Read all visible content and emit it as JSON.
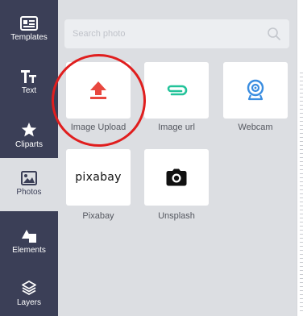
{
  "sidebar": {
    "items": [
      {
        "label": "Templates",
        "icon": "templates-icon"
      },
      {
        "label": "Text",
        "icon": "text-icon"
      },
      {
        "label": "Cliparts",
        "icon": "star-icon"
      },
      {
        "label": "Photos",
        "icon": "photo-icon",
        "active": true
      },
      {
        "label": "Elements",
        "icon": "shapes-icon"
      },
      {
        "label": "Layers",
        "icon": "layers-icon"
      }
    ]
  },
  "search": {
    "placeholder": "Search photo"
  },
  "sources": [
    {
      "label": "Image Upload",
      "icon": "upload-icon",
      "color": "#e8473f"
    },
    {
      "label": "Image url",
      "icon": "paperclip-icon",
      "color": "#23c39a"
    },
    {
      "label": "Webcam",
      "icon": "webcam-icon",
      "color": "#3a8de0"
    },
    {
      "label": "Pixabay",
      "logo": "pixabay"
    },
    {
      "label": "Unsplash",
      "icon": "camera-icon",
      "color": "#111111"
    }
  ],
  "colors": {
    "sidebar": "#3b3f57",
    "panel": "#dcdee2",
    "annotation": "#e01e1e"
  }
}
